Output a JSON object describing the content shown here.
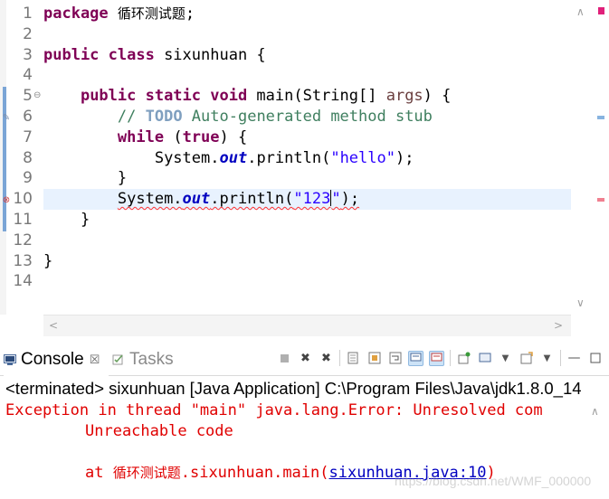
{
  "editor": {
    "line_numbers": [
      "1",
      "2",
      "3",
      "4",
      "5",
      "6",
      "7",
      "8",
      "9",
      "10",
      "11",
      "12",
      "13",
      "14"
    ],
    "code": {
      "l1_kw": "package",
      "l1_pkg": "循环测试题",
      "l1_semi": ";",
      "l3_kw": "public class",
      "l3_rest": " sixunhuan {",
      "l5_kw": "public static void",
      "l5_a": " main(String[] ",
      "l5_param": "args",
      "l5_b": ") {",
      "l6_slash": "// ",
      "l6_todo": "TODO",
      "l6_rest": " Auto-generated method stub",
      "l7_kw1": "while",
      "l7_a": " (",
      "l7_kw2": "true",
      "l7_b": ") {",
      "l8_a": "System.",
      "l8_field": "out",
      "l8_b": ".println(",
      "l8_str": "\"hello\"",
      "l8_c": ");",
      "l9": "}",
      "l10_a": "System.",
      "l10_field": "out",
      "l10_b": ".println(",
      "l10_str1": "\"123",
      "l10_str2": "\"",
      "l10_c": ");",
      "l11": "}",
      "l13": "}"
    }
  },
  "console": {
    "tabs": [
      {
        "label": "Console",
        "close": "☒"
      },
      {
        "label": "Tasks"
      }
    ],
    "status": "<terminated> sixunhuan [Java Application] C:\\Program Files\\Java\\jdk1.8.0_14",
    "lines": {
      "exception": "Exception in thread \"main\" java.lang.Error: Unresolved com",
      "unreachable": "Unreachable code",
      "at_prefix": "at ",
      "at_pkg": "循环测试题",
      "at_method": ".sixunhuan.main(",
      "at_link": "sixunhuan.java:10",
      "at_close": ")"
    }
  },
  "watermark": "https://blog.csdn.net/WMF_000000",
  "colors": {
    "keyword": "#7f0055",
    "comment": "#3f7f5f",
    "string": "#2a00ff",
    "field": "#0000c0",
    "error": "#e00000",
    "current_line": "#e8f2fe"
  }
}
